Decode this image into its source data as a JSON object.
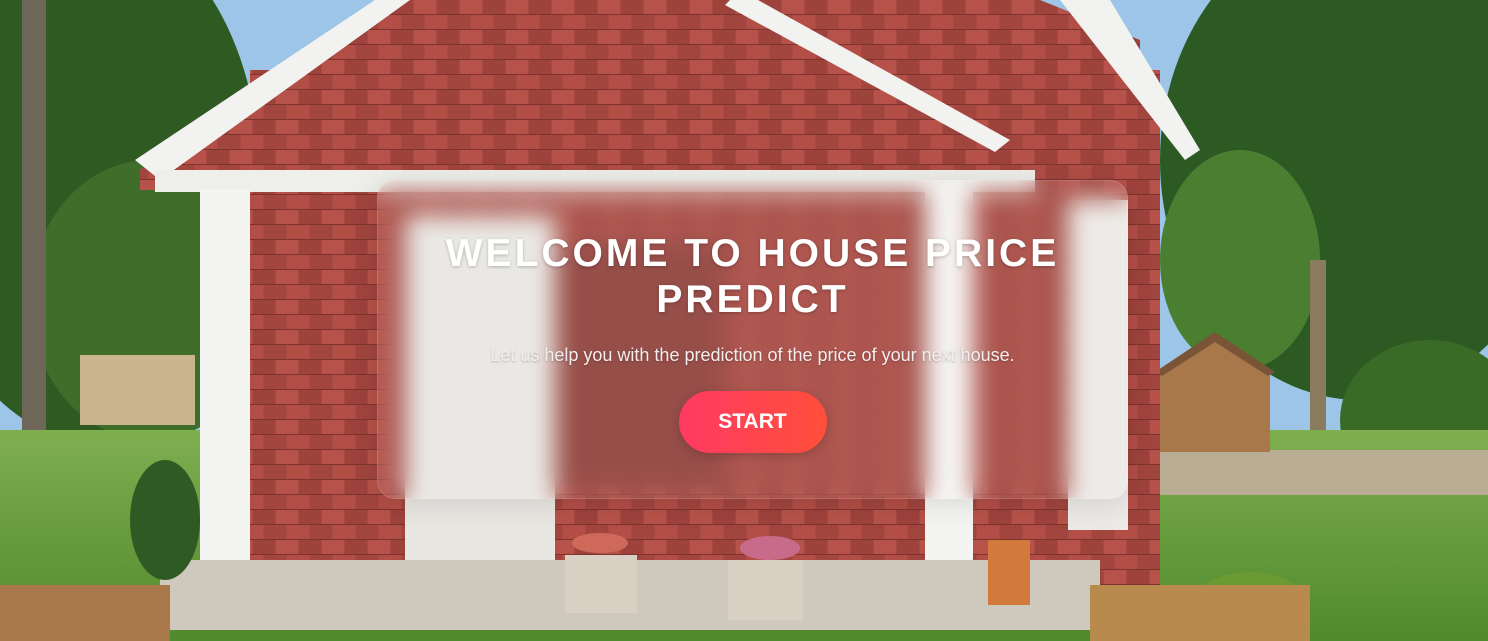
{
  "hero": {
    "title": "WELCOME TO HOUSE PRICE PREDICT",
    "subtitle": "Let us help you with the prediction of the price of your next house.",
    "start_label": "START"
  },
  "colors": {
    "button_gradient_start": "#ff3a63",
    "button_gradient_end": "#ff4f3a",
    "siding": "#a8453f",
    "sky": "#9cc5e8"
  }
}
